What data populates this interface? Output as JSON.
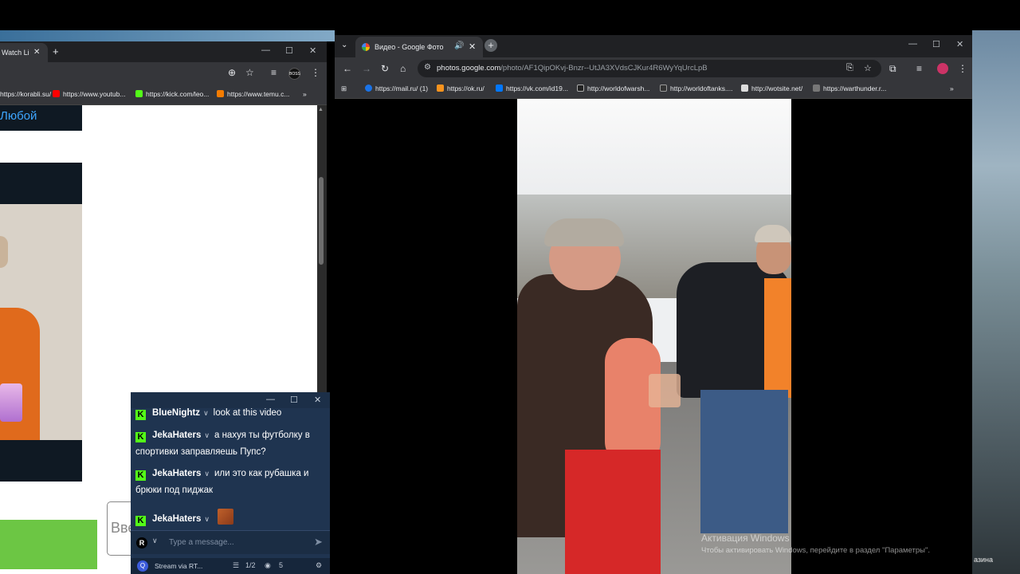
{
  "left_browser": {
    "tab_title": "Watch Li",
    "bookmarks": [
      "https://korabli.su/",
      "https://www.youtub...",
      "https://kick.com/leo...",
      "https://www.temu.c..."
    ],
    "boss_badge": "BOSS",
    "page_text_lyuboy": "Любой",
    "input_placeholder": "Вве"
  },
  "chat": {
    "messages": [
      {
        "user": "BlueNightz",
        "text": "look at this video"
      },
      {
        "user": "JekaHaters",
        "text": "а нахуя ты футболку в спортивки заправляешь Пупс?"
      },
      {
        "user": "JekaHaters",
        "text": "или это как рубашка и брюки под пиджак"
      },
      {
        "user": "JekaHaters",
        "text": ""
      }
    ],
    "input_badge": "R",
    "input_placeholder": "Type a message...",
    "footer_label": "Stream via RT...",
    "footer_page": "1/2",
    "footer_viewers": "5"
  },
  "right_browser": {
    "tab_title": "Видео - Google Фото",
    "url_host": "photos.google.com",
    "url_path": "/photo/AF1QipOKvj-Bnzr--UtJA3XVdsCJKur4R6WyYqUrcLpB",
    "bookmarks": [
      "https://mail.ru/ (1)",
      "https://ok.ru/",
      "https://vk.com/id19...",
      "http://worldofwarsh...",
      "http://worldoftanks....",
      "http://wotsite.net/",
      "https://warthunder.r..."
    ]
  },
  "windows_activation": {
    "title": "Активация Windows",
    "subtitle": "Чтобы активировать Windows, перейдите в раздел \"Параметры\"."
  },
  "taskbar_corner_text": "азина",
  "colors": {
    "kick_green": "#53fc18",
    "chat_bg": "#1f3450",
    "browser_dark": "#202124"
  }
}
